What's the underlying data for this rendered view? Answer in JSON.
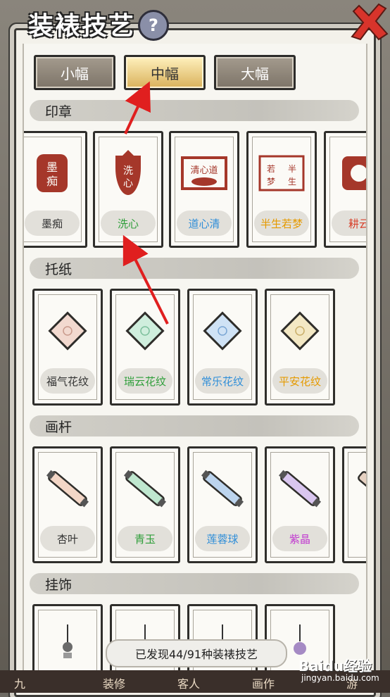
{
  "header": {
    "title": "装裱技艺",
    "help": "?"
  },
  "tabs": [
    {
      "label": "小幅",
      "active": false
    },
    {
      "label": "中幅",
      "active": true
    },
    {
      "label": "大幅",
      "active": false
    }
  ],
  "sections": [
    {
      "label": "印章",
      "items": [
        {
          "name": "墨痴",
          "color": "#333333",
          "seal": "墨痴"
        },
        {
          "name": "洗心",
          "color": "#2f9e3a",
          "seal": "洗心"
        },
        {
          "name": "道心清",
          "color": "#2f8ed8",
          "seal": "道心清"
        },
        {
          "name": "半生若梦",
          "color": "#e59a00",
          "seal": "半生若梦"
        },
        {
          "name": "耕云",
          "color": "#d8402a",
          "seal": "耕云"
        }
      ]
    },
    {
      "label": "托纸",
      "items": [
        {
          "name": "福气花纹",
          "color": "#333333",
          "tint": "#f2d9cf"
        },
        {
          "name": "瑞云花纹",
          "color": "#2f9e3a",
          "tint": "#cfeedd"
        },
        {
          "name": "常乐花纹",
          "color": "#2f8ed8",
          "tint": "#cfe2f5"
        },
        {
          "name": "平安花纹",
          "color": "#e59a00",
          "tint": "#f3e8c4"
        }
      ]
    },
    {
      "label": "画杆",
      "items": [
        {
          "name": "杏叶",
          "color": "#333333",
          "tint": "#f3d6c6"
        },
        {
          "name": "青玉",
          "color": "#2f9e3a",
          "tint": "#bfe7cf"
        },
        {
          "name": "莲蓉球",
          "color": "#2f8ed8",
          "tint": "#bcd4ee"
        },
        {
          "name": "紫晶",
          "color": "#c13ad0",
          "tint": "#d9c6ef"
        },
        {
          "name": "",
          "color": "#333333",
          "tint": "#e6d1c1"
        }
      ]
    },
    {
      "label": "挂饰",
      "items": [
        {
          "name": "",
          "color": "#333333"
        },
        {
          "name": "",
          "color": "#333333"
        },
        {
          "name": "",
          "color": "#333333"
        },
        {
          "name": "",
          "color": "#333333"
        }
      ]
    }
  ],
  "footer": {
    "discovered": "已发现44/91种装裱技艺"
  },
  "bottom_tabs": [
    "九",
    "装修",
    "客人",
    "画作",
    "游"
  ],
  "watermark": {
    "brand": "Baidu经验",
    "url": "jingyan.baidu.com"
  }
}
